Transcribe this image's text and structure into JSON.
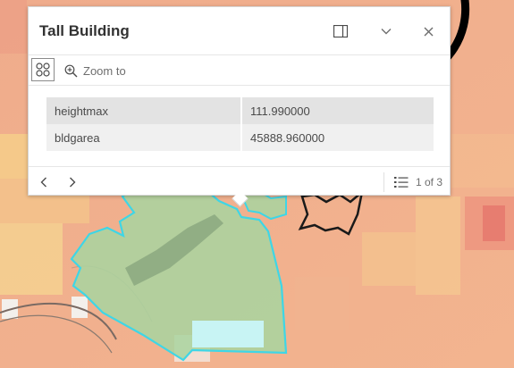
{
  "popup": {
    "title": "Tall Building",
    "zoom_label": "Zoom to",
    "attributes": [
      {
        "field": "heightmax",
        "value": "111.990000"
      },
      {
        "field": "bldgarea",
        "value": "45888.960000"
      }
    ],
    "feature_count": "1 of 3"
  },
  "icons": {
    "dock": "dock-panel-icon",
    "collapse": "chevron-down-icon",
    "close": "close-icon",
    "select": "select-features-icon",
    "zoom": "zoom-in-icon",
    "prev": "chevron-left-icon",
    "next": "chevron-right-icon",
    "list": "feature-list-icon",
    "annotation": "curved-arrow-icon"
  },
  "colors": {
    "map_base": "#f1b08f",
    "selected_fill": "#a8d5a0",
    "selected_outline": "#3ed6e6",
    "highlight_fill": "#c8f4f4",
    "annotation_arrow": "#000000"
  }
}
